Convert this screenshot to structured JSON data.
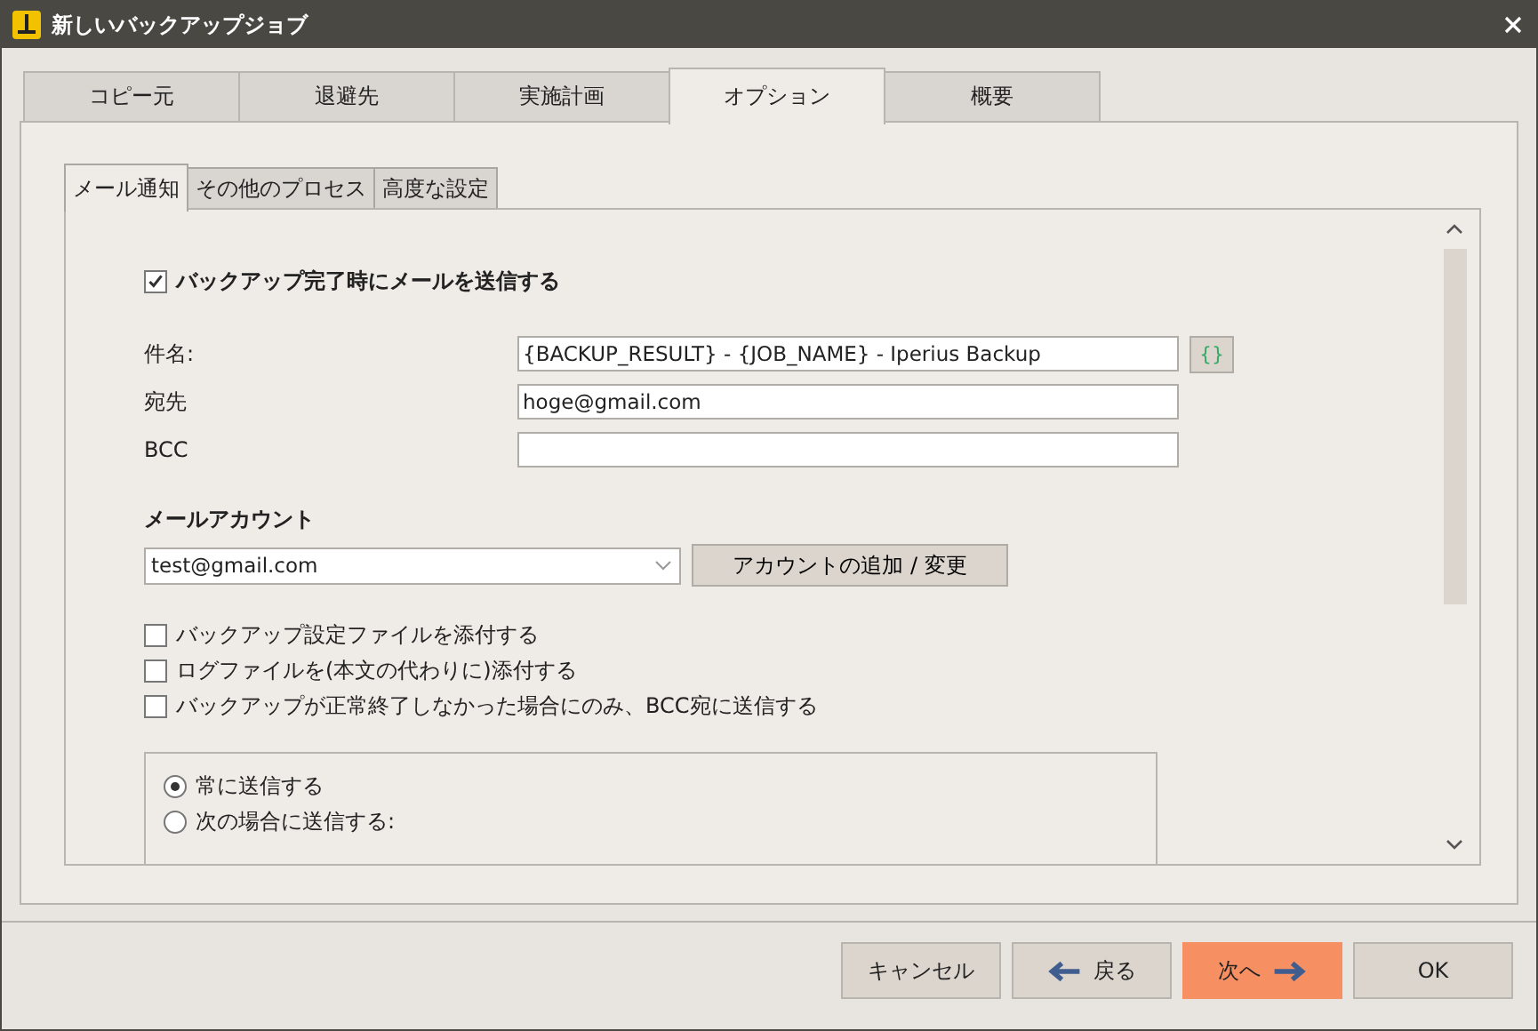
{
  "window": {
    "title": "新しいバックアップジョブ"
  },
  "tabs": [
    {
      "label": "コピー元",
      "selected": false
    },
    {
      "label": "退避先",
      "selected": false
    },
    {
      "label": "実施計画",
      "selected": false
    },
    {
      "label": "オプション",
      "selected": true
    },
    {
      "label": "概要",
      "selected": false
    }
  ],
  "subtabs": [
    {
      "label": "メール通知",
      "selected": true
    },
    {
      "label": "その他のプロセス",
      "selected": false
    },
    {
      "label": "高度な設定",
      "selected": false
    }
  ],
  "send_on_completion": {
    "label": "バックアップ完了時にメールを送信する",
    "checked": true
  },
  "fields": [
    {
      "label": "件名:",
      "value": "{BACKUP_RESULT} - {JOB_NAME} - Iperius Backup",
      "variables_button": "{}"
    },
    {
      "label": "宛先",
      "value": "hoge@gmail.com"
    },
    {
      "label": "BCC"
    }
  ],
  "account": {
    "heading": "メールアカウント",
    "value": "test@gmail.com",
    "button": "アカウントの追加 / 変更"
  },
  "options": [
    {
      "label": "バックアップ設定ファイルを添付する",
      "checked": false
    },
    {
      "label": "ログファイルを(本文の代わりに)添付する",
      "checked": false
    },
    {
      "label": "バックアップが正常終了しなかった場合にのみ、BCC宛に送信する",
      "checked": false
    }
  ],
  "send_mode": [
    {
      "label": "常に送信する",
      "selected": true
    },
    {
      "label": "次の場合に送信する:",
      "selected": false
    }
  ],
  "buttons": [
    {
      "label": "キャンセル",
      "kind": "plain"
    },
    {
      "label": "戻る",
      "kind": "back"
    },
    {
      "label": "次へ",
      "kind": "next"
    },
    {
      "label": "OK",
      "kind": "plain"
    }
  ]
}
